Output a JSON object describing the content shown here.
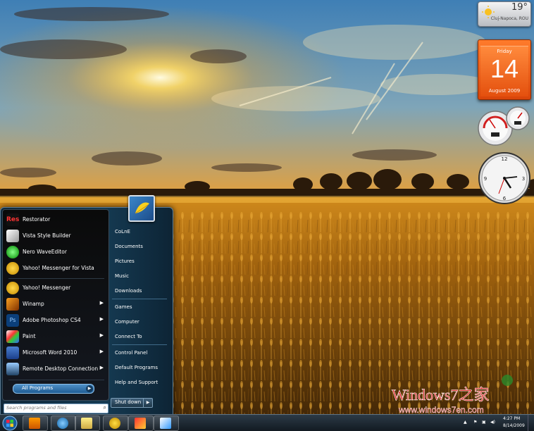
{
  "weather": {
    "temperature": "19°",
    "location": "Cluj-Napoca, ROU"
  },
  "calendar": {
    "weekday": "Friday",
    "day": "14",
    "month_year": "August 2009"
  },
  "start_menu": {
    "pinned": [
      {
        "label": "Restorator",
        "icon": "restorator-icon"
      },
      {
        "label": "Vista Style Builder",
        "icon": "vista-style-builder-icon"
      },
      {
        "label": "Nero WaveEditor",
        "icon": "nero-waveeditor-icon"
      },
      {
        "label": "Yahoo! Messenger for Vista",
        "icon": "yahoo-messenger-icon"
      }
    ],
    "recent": [
      {
        "label": "Yahoo! Messenger",
        "icon": "yahoo-messenger-icon",
        "submenu": false
      },
      {
        "label": "Winamp",
        "icon": "winamp-icon",
        "submenu": true
      },
      {
        "label": "Adobe Photoshop CS4",
        "icon": "photoshop-icon",
        "submenu": true
      },
      {
        "label": "Paint",
        "icon": "paint-icon",
        "submenu": true
      },
      {
        "label": "Microsoft Word 2010",
        "icon": "word-icon",
        "submenu": true
      },
      {
        "label": "Remote Desktop Connection",
        "icon": "remote-desktop-icon",
        "submenu": true
      }
    ],
    "all_programs": "All Programs",
    "search_placeholder": "Search programs and files",
    "right_links": [
      "CoLnE",
      "Documents",
      "Pictures",
      "Music",
      "Downloads",
      "Games",
      "Computer",
      "Connect To",
      "Control Panel",
      "Default Programs",
      "Help and Support"
    ],
    "shutdown": "Shut down"
  },
  "taskbar": {
    "pinned": [
      "media-player-icon",
      "internet-explorer-icon",
      "explorer-folder-icon",
      "yahoo-messenger-icon",
      "windows-update-icon",
      "paint-icon"
    ],
    "time": "4:27 PM",
    "date": "8/14/2009"
  },
  "watermark": {
    "brand": "Windows7之家",
    "url": "www.windows7en.com"
  },
  "colors": {
    "taskbar": "#1a252f",
    "start_menu": "#153a52",
    "calendar": "#e4500e",
    "accent": "#3b86c8"
  }
}
